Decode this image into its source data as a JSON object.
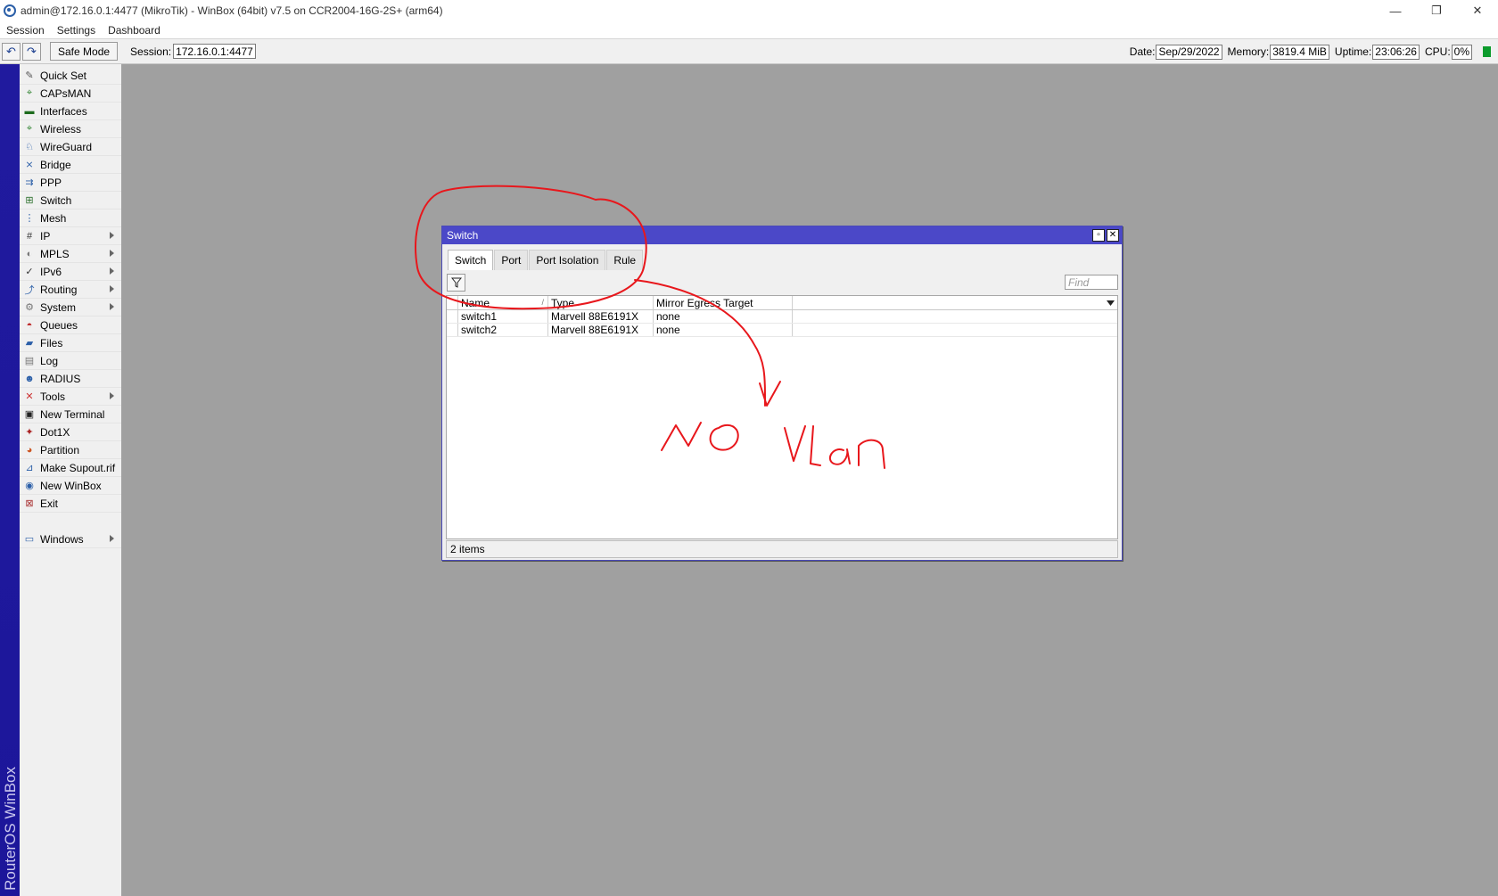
{
  "window": {
    "title": "admin@172.16.0.1:4477 (MikroTik) - WinBox (64bit) v7.5 on CCR2004-16G-2S+ (arm64)",
    "controls": {
      "minimize": "—",
      "restore": "❐",
      "close": "✕"
    }
  },
  "menu": [
    "Session",
    "Settings",
    "Dashboard"
  ],
  "toolbar": {
    "undo_icon": "↶",
    "redo_icon": "↷",
    "safe_mode": "Safe Mode",
    "session_label": "Session:",
    "session_value": "172.16.0.1:4477",
    "date_label": "Date:",
    "date_value": "Sep/29/2022",
    "memory_label": "Memory:",
    "memory_value": "3819.4 MiB",
    "uptime_label": "Uptime:",
    "uptime_value": "23:06:26",
    "cpu_label": "CPU:",
    "cpu_value": "0%",
    "cpu_indicator_color": "#0c9b2c"
  },
  "sidebar": {
    "brand": "RouterOS WinBox",
    "items": [
      {
        "label": "Quick Set",
        "icon": "wand-icon",
        "glyph": "✎",
        "color": "#555",
        "sub": false
      },
      {
        "label": "CAPsMAN",
        "icon": "capsman-icon",
        "glyph": "⌖",
        "color": "#3a8a3a",
        "sub": false
      },
      {
        "label": "Interfaces",
        "icon": "interfaces-icon",
        "glyph": "▬",
        "color": "#1d6b1d",
        "sub": false
      },
      {
        "label": "Wireless",
        "icon": "wireless-icon",
        "glyph": "⌖",
        "color": "#3a8a3a",
        "sub": false
      },
      {
        "label": "WireGuard",
        "icon": "wireguard-icon",
        "glyph": "♘",
        "color": "#2b5fa8",
        "sub": false
      },
      {
        "label": "Bridge",
        "icon": "bridge-icon",
        "glyph": "⨯",
        "color": "#2b5fa8",
        "sub": false
      },
      {
        "label": "PPP",
        "icon": "ppp-icon",
        "glyph": "⇉",
        "color": "#2b5fa8",
        "sub": false
      },
      {
        "label": "Switch",
        "icon": "switch-icon",
        "glyph": "⊞",
        "color": "#2b6f2b",
        "sub": false
      },
      {
        "label": "Mesh",
        "icon": "mesh-icon",
        "glyph": "⋮",
        "color": "#2b5fa8",
        "sub": false
      },
      {
        "label": "IP",
        "icon": "ip-icon",
        "glyph": "#",
        "color": "#333",
        "sub": true
      },
      {
        "label": "MPLS",
        "icon": "mpls-icon",
        "glyph": "◐",
        "color": "#777",
        "sub": true
      },
      {
        "label": "IPv6",
        "icon": "ipv6-icon",
        "glyph": "✓",
        "color": "#333",
        "sub": true
      },
      {
        "label": "Routing",
        "icon": "routing-icon",
        "glyph": "⤴",
        "color": "#2b5fa8",
        "sub": true
      },
      {
        "label": "System",
        "icon": "system-icon",
        "glyph": "⚙",
        "color": "#777",
        "sub": true
      },
      {
        "label": "Queues",
        "icon": "queues-icon",
        "glyph": "◓",
        "color": "#b22",
        "sub": false
      },
      {
        "label": "Files",
        "icon": "files-icon",
        "glyph": "▰",
        "color": "#2b5fa8",
        "sub": false
      },
      {
        "label": "Log",
        "icon": "log-icon",
        "glyph": "▤",
        "color": "#777",
        "sub": false
      },
      {
        "label": "RADIUS",
        "icon": "radius-icon",
        "glyph": "☻",
        "color": "#2b5fa8",
        "sub": false
      },
      {
        "label": "Tools",
        "icon": "tools-icon",
        "glyph": "✕",
        "color": "#c33",
        "sub": true
      },
      {
        "label": "New Terminal",
        "icon": "terminal-icon",
        "glyph": "▣",
        "color": "#222",
        "sub": false
      },
      {
        "label": "Dot1X",
        "icon": "dot1x-icon",
        "glyph": "✦",
        "color": "#a22",
        "sub": false
      },
      {
        "label": "Partition",
        "icon": "partition-icon",
        "glyph": "◕",
        "color": "#c52",
        "sub": false
      },
      {
        "label": "Make Supout.rif",
        "icon": "supout-icon",
        "glyph": "⊿",
        "color": "#2b5fa8",
        "sub": false
      },
      {
        "label": "New WinBox",
        "icon": "winbox-icon",
        "glyph": "◉",
        "color": "#2b5fa8",
        "sub": false
      },
      {
        "label": "Exit",
        "icon": "exit-icon",
        "glyph": "⊠",
        "color": "#a33",
        "sub": false
      }
    ],
    "bottom_item": {
      "label": "Windows",
      "icon": "windows-icon",
      "glyph": "▭",
      "color": "#2b5fa8",
      "sub": true
    }
  },
  "switch_window": {
    "title": "Switch",
    "tabs": [
      {
        "label": "Switch",
        "active": true
      },
      {
        "label": "Port",
        "active": false
      },
      {
        "label": "Port Isolation",
        "active": false
      },
      {
        "label": "Rule",
        "active": false
      }
    ],
    "find_placeholder": "Find",
    "columns": [
      "Name",
      "Type",
      "Mirror Egress Target"
    ],
    "rows": [
      {
        "name": "switch1",
        "type": "Marvell 88E6191X",
        "mirror": "none"
      },
      {
        "name": "switch2",
        "type": "Marvell 88E6191X",
        "mirror": "none"
      }
    ],
    "status": "2 items"
  },
  "annotation": {
    "color": "#e8171c"
  }
}
